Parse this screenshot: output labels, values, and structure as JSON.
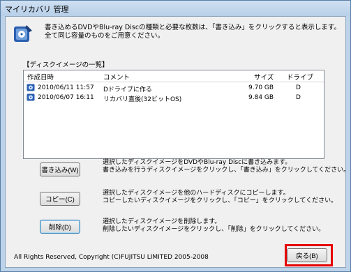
{
  "window": {
    "title": "マイリカバリ 管理"
  },
  "intro": {
    "line1": "書き込めるDVDやBlu-ray Discの種類と必要な枚数は、「書き込み」をクリックすると表示します。",
    "line2": "全て同じ容量のものをご用意ください。"
  },
  "disk_list": {
    "group_label": "【ディスクイメージの一覧】",
    "columns": [
      "作成日時",
      "コメント",
      "サイズ",
      "ドライブ"
    ],
    "rows": [
      {
        "date": "2010/06/11 11:57",
        "comment": "Dドライブに作る",
        "size": "9.70 GB",
        "drive": "D"
      },
      {
        "date": "2010/06/07 16:11",
        "comment": "リカバリ直後(32ビットOS)",
        "size": "9.84 GB",
        "drive": "D"
      }
    ]
  },
  "actions": {
    "write": {
      "label": "書き込み(W)",
      "desc1": "選択したディスクイメージをDVDやBlu-ray Discに書き込みます。",
      "desc2": "書き込みを行うディスクイメージをクリックし、「書き込み」をクリックしてください。"
    },
    "copy": {
      "label": "コピー(C)",
      "desc1": "選択したディスクイメージを他のハードディスクにコピーします。",
      "desc2": "コピーしたいディスクイメージをクリックし、「コピー」をクリックしてください。"
    },
    "delete": {
      "label": "削除(D)",
      "desc1": "選択したディスクイメージを削除します。",
      "desc2": "削除したいディスクイメージをクリックし、「削除」をクリックしてください。"
    }
  },
  "footer": {
    "copyright": "All Rights Reserved, Copyright (C)FUJITSU LIMITED 2005-2008",
    "back_label": "戻る(B)"
  },
  "colors": {
    "highlight": "#e60000",
    "icon_blue": "#2a5fb0"
  }
}
